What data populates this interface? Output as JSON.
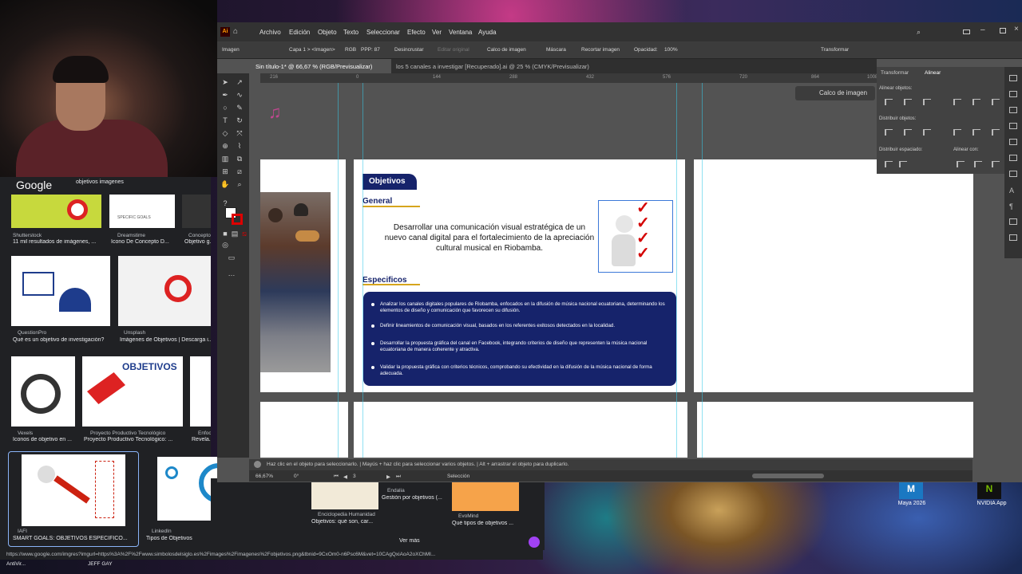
{
  "illustrator": {
    "app_badge": "Ai",
    "menu": [
      "Archivo",
      "Edición",
      "Objeto",
      "Texto",
      "Seleccionar",
      "Efecto",
      "Ver",
      "Ventana",
      "Ayuda"
    ],
    "control_bar": {
      "selection_label": "Imagen",
      "layer": "Capa 1 > <Imagen>",
      "color_mode": "RGB",
      "ppp": "PPP: 87",
      "unembed": "Desincrustar",
      "edit_original": "Editar original",
      "image_trace": "Calco de imagen",
      "mask": "Máscara",
      "crop": "Recortar imagen",
      "opacity_label": "Opacidad:",
      "opacity_value": "100%",
      "transform": "Transformar"
    },
    "tabs": [
      "Sin título-1* @ 66,67 % (RGB/Previsualizar)",
      "los 5 canales a investigar [Recuperado].ai @ 25 % (CMYK/Previsualizar)"
    ],
    "ruler_ticks": [
      "216",
      "0",
      "144",
      "288",
      "432",
      "576",
      "720",
      "864",
      "1008",
      "1152",
      "1296"
    ],
    "trace_button": "Calco de imagen",
    "right_panel": {
      "tab_transform": "Transformar",
      "tab_align": "Alinear",
      "align_objects": "Alinear objetos:",
      "distribute_objects": "Distribuir objetos:",
      "distribute_spacing": "Distribuir espaciado:",
      "align_to": "Alinear con:"
    },
    "status_hint": "Haz clic en el objeto para seleccionarlo. | Mayús + haz clic para seleccionar varios objetos. | Alt + arrastrar el objeto para duplicarlo.",
    "zoom": "66,67%",
    "rotation": "0°",
    "artboard_num": "3",
    "mode": "Selección"
  },
  "artboard": {
    "badge": "Objetivos",
    "general_heading": "General",
    "general_text": "Desarrollar una comunicación visual estratégica de un nuevo canal digital para el fortalecimiento de la apreciación cultural musical en Riobamba.",
    "specific_heading": "Especificos",
    "specific_items": [
      "Analizar los canales digitales populares de Riobamba, enfocados en la difusión de música nacional ecuatoriana, determinando los elementos de diseño y comunicación que favorecen su difusión.",
      "Definir lineamientos de comunicación visual, basados en los referentes exitosos detectados en la localidad.",
      "Desarrollar la propuesta gráfica del canal en Facebook, integrando criterios de diseño que representen la música nacional ecuatoriana de manera coherente y atractiva.",
      "Validar la propuesta gráfica con criterios técnicos, comprobando su efectividad en la difusión de la música nacional de forma adecuada."
    ]
  },
  "browser": {
    "logo": "Google",
    "query": "objetivos imagenes",
    "results": [
      {
        "source": "Shutterstock",
        "title": "11 mil resultados de imágenes, ..."
      },
      {
        "source": "Dreamstime",
        "title": "Icono De Concepto D..."
      },
      {
        "source": "Concepto",
        "title": "Objetivo g..."
      },
      {
        "source": "QuestionPro",
        "title": "Qué es un objetivo de investigación?"
      },
      {
        "source": "Unsplash",
        "title": "Imágenes de Objetivos | Descarga i..."
      },
      {
        "source": "Vexels",
        "title": "Íconos de objetivo en ..."
      },
      {
        "source": "Proyecto Productivo Tecnológico",
        "title": "Proyecto Productivo Tecnológico: ..."
      },
      {
        "source": "Enfoc",
        "title": "Revela..."
      },
      {
        "source": "IAFI",
        "title": "SMART GOALS: OBJETIVOS ESPECÍFICO..."
      },
      {
        "source": "LinkedIn",
        "title": "Tipos de Objetivos"
      },
      {
        "source": "Enciclopedia Humanidad",
        "title": "Objetivos: qué son, car..."
      },
      {
        "source": "Endalia",
        "title": "Gestión por objetivos (..."
      },
      {
        "source": "EvoMind",
        "title": "Qué tipos de objetivos ..."
      }
    ],
    "thumb_text": {
      "objetivos": "OBJETIVOS",
      "specific_goals": "SPECIFIC GOALS"
    },
    "see_more": "Ver más",
    "status_url": "https://www.google.com/imgres?imgurl=https%3A%2F%2Fwww.simbolosdelsiglo.es%2Fimages%2Fimagenes%2Fobjetivos.png&tbnid=9CxOm0-n6Psc6M&vet=10CAgQxiAoA2oXChMI...",
    "taskbar_left": "AntiVir...",
    "taskbar_name": "JEFF GAY"
  },
  "desktop": {
    "icons": [
      {
        "label": "Maya 2026",
        "badge": "M"
      },
      {
        "label": "NVIDIA App",
        "badge": "N"
      }
    ]
  }
}
